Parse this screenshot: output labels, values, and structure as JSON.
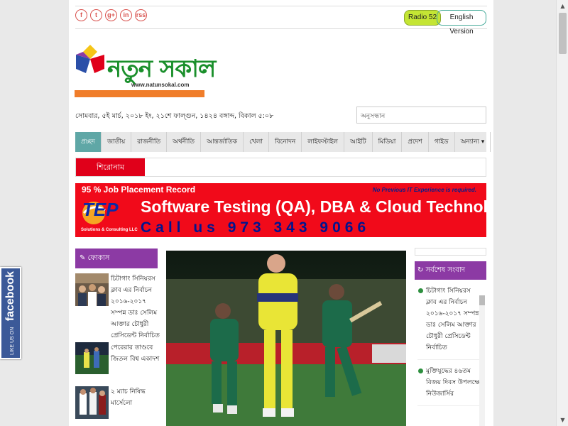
{
  "social": [
    "f",
    "t",
    "g+",
    "in",
    "rss"
  ],
  "header": {
    "radio": "Radio 52",
    "english": "English Version"
  },
  "logo": {
    "name": "নতুন সকাল",
    "url": "www.natunsokal.com"
  },
  "dateline": "সোমবার, ৫ই মার্চ, ২০১৮ ইং, ২১শে ফাল্গুন, ১৪২৪ বঙ্গাব্দ, বিকাল ৫:০৮",
  "search": {
    "placeholder": "অনুসন্ধান"
  },
  "nav": [
    "প্রচ্ছদ",
    "জাতীয়",
    "রাজনীতি",
    "অর্থনীতি",
    "আন্তর্জাতিক",
    "খেলা",
    "বিনোদন",
    "লাইফস্টাইল",
    "আইটি",
    "মিডিয়া",
    "প্রদেশ",
    "গাইড",
    "অন্যান্য ▾"
  ],
  "ticker": {
    "label": "শিরোনাম"
  },
  "ad": {
    "line1": "95 % Job Placement Record",
    "note": "No Previous IT Experience is required.",
    "headline": "Software Testing (QA), DBA & Cloud Technology",
    "phone": "Call us 973 343 9066",
    "brand": "TEP",
    "brand_sub": "Solutions & Consulting LLC"
  },
  "focus": {
    "title": "ফোকাস",
    "items": [
      "চিটাগাং সিনিয়রস ক্লাব এর নির্বাচন ২০১৬-২০১৭ সম্পন্ন ডাঃ সেলিম আক্তার চৌধুরী প্রেসিডেন্ট নির্বাচিত",
      "পেরেরার তাণ্ডবে জিতল বিশ্ব একাদশ",
      "২ ম্যাচ নিষিদ্ধ মার্সেলো"
    ]
  },
  "latest": {
    "title": "সর্বশেষ সংবাদ",
    "items": [
      "চিটাগাং সিনিয়রস ক্লাব এর নির্বাচন ২০১৬-২০১৭ সম্পন্ন ডাঃ সেলিম আক্তার চৌধুরী প্রেসিডেন্ট নির্বাচিত",
      "মুক্তিযুদ্ধের ৪৬তম বিজয় দিবস উপলক্ষে নিউজার্সির"
    ]
  },
  "fb_badge": {
    "small": "LIKE US ON",
    "big": "facebook"
  },
  "colors": {
    "purple": "#8c3aa4",
    "red": "#e0001a",
    "green": "#1a8f2b",
    "teal": "#5fa7a6"
  }
}
